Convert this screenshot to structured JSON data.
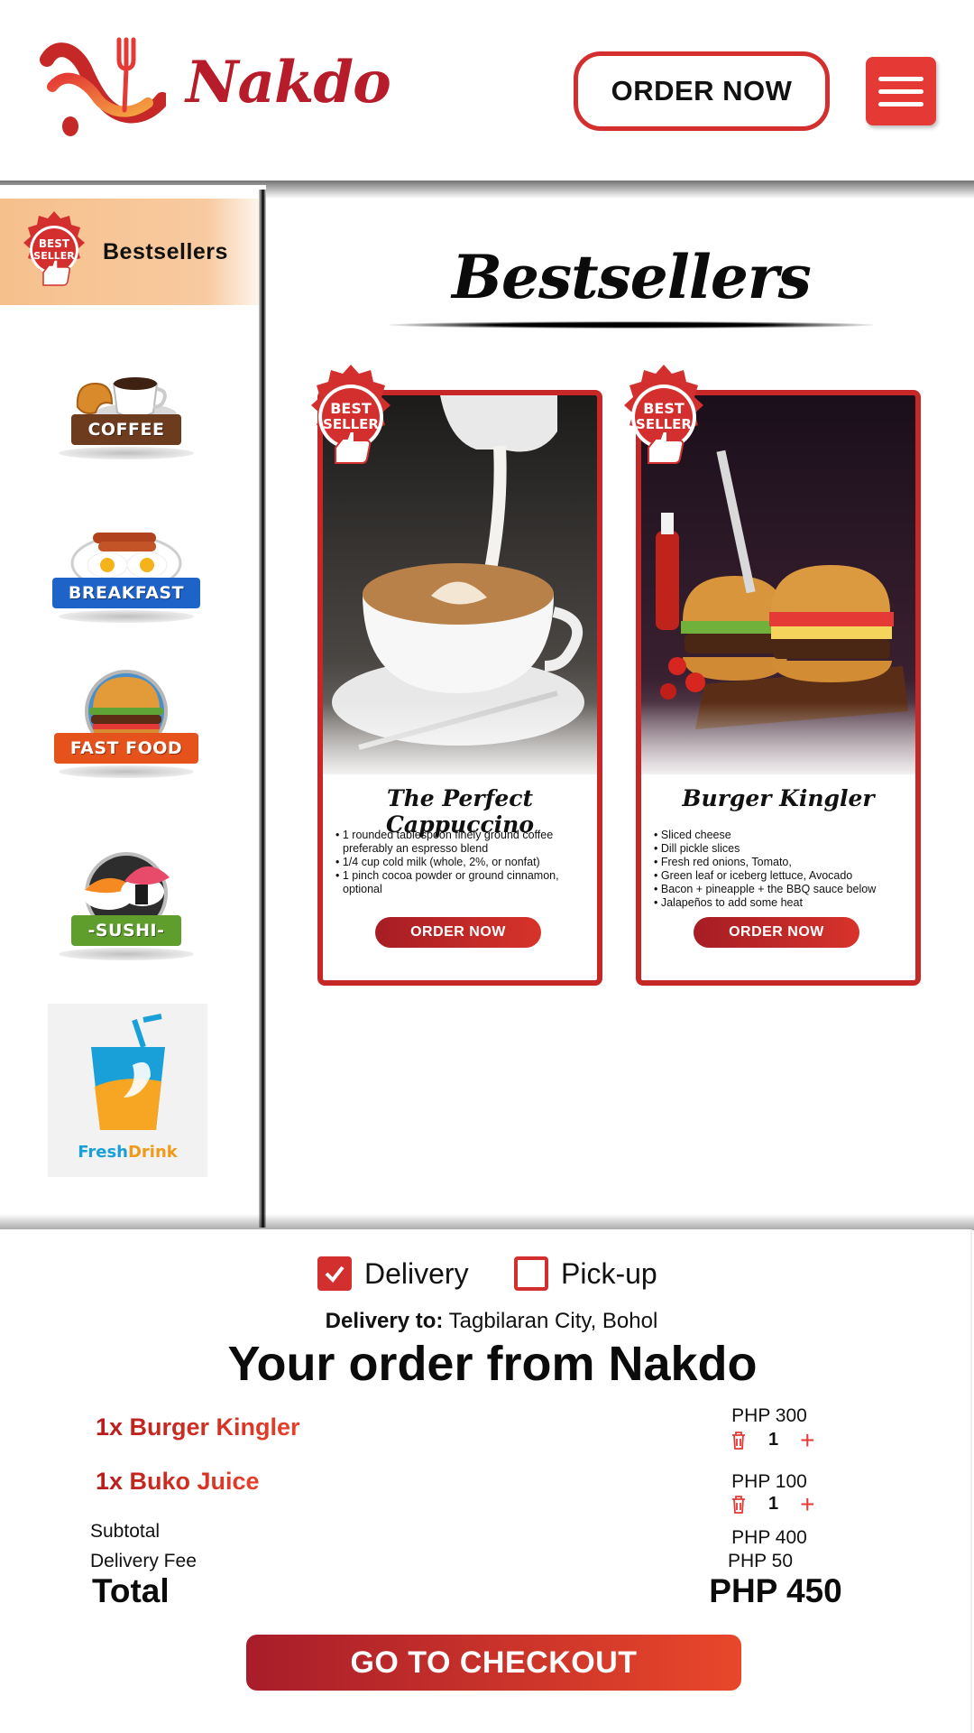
{
  "header": {
    "brand": "Nakdo",
    "order_now_label": "ORDER NOW",
    "menu_icon": "hamburger-menu-icon",
    "accent_color": "#d32f2f"
  },
  "sidebar": {
    "active_item": {
      "label": "Bestsellers",
      "icon": "best-seller-badge-icon"
    },
    "categories": [
      {
        "label": "COFFEE",
        "icon": "coffee-icon"
      },
      {
        "label": "BREAKFAST",
        "icon": "breakfast-icon"
      },
      {
        "label": "FAST FOOD",
        "icon": "burger-icon"
      },
      {
        "label": "-SUSHI-",
        "icon": "sushi-icon"
      },
      {
        "label_a": "Fresh",
        "label_b": "Drink",
        "icon": "drink-cup-icon"
      }
    ]
  },
  "main": {
    "title": "Bestsellers",
    "badge_line1": "BEST",
    "badge_line2": "SELLER",
    "cards": [
      {
        "name": "The Perfect Cappuccino",
        "ingredients": [
          "1 rounded tablespoon finely ground coffee preferably an espresso blend",
          "1/4 cup cold milk (whole, 2%, or nonfat)",
          "1 pinch cocoa powder or ground cinnamon, optional"
        ],
        "button": "ORDER NOW"
      },
      {
        "name": "Burger Kingler",
        "ingredients": [
          "Sliced cheese",
          "Dill pickle slices",
          "Fresh red onions, Tomato,",
          "Green leaf or iceberg lettuce, Avocado",
          "Bacon + pineapple + the BBQ sauce below",
          "Jalapeños to add some heat"
        ],
        "button": "ORDER NOW"
      }
    ]
  },
  "order": {
    "delivery_label": "Delivery",
    "delivery_checked": true,
    "pickup_label": "Pick-up",
    "pickup_checked": false,
    "delivery_to_label": "Delivery to:",
    "delivery_to_value": "Tagbilaran City, Bohol",
    "heading": "Your order from Nakdo",
    "items": [
      {
        "name": "1x Burger Kingler",
        "price": "PHP 300",
        "qty": "1"
      },
      {
        "name": "1x Buko Juice",
        "price": "PHP 100",
        "qty": "1"
      }
    ],
    "subtotal_label": "Subtotal",
    "subtotal_value": "PHP 400",
    "delivery_fee_label": "Delivery Fee",
    "delivery_fee_value": "PHP 50",
    "total_label": "Total",
    "total_value": "PHP 450",
    "checkout_label": "GO TO CHECKOUT"
  }
}
